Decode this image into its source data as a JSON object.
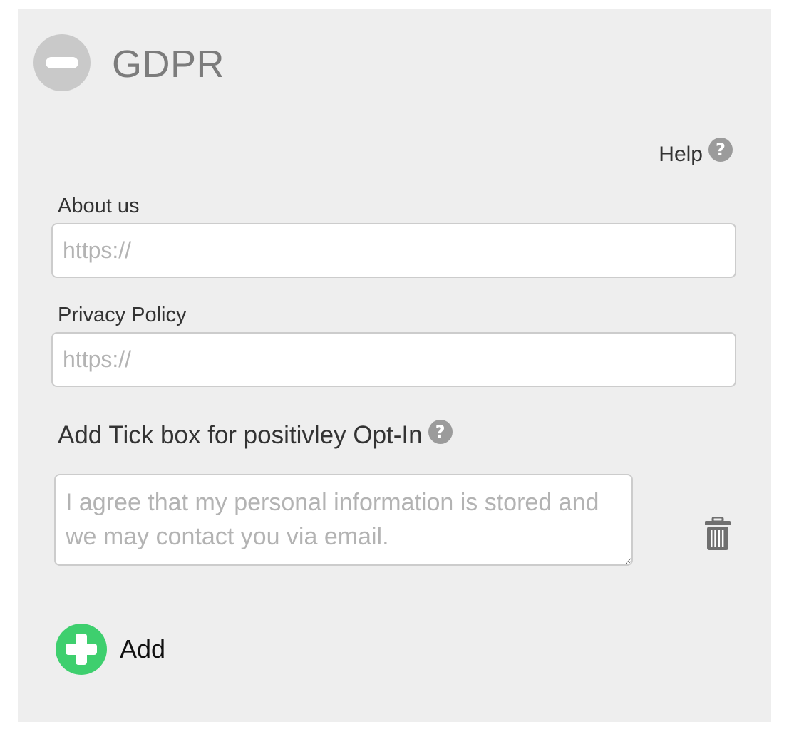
{
  "section": {
    "title": "GDPR",
    "collapse_icon": "minus-circle-icon"
  },
  "help": {
    "label": "Help",
    "icon": "question-circle-icon"
  },
  "fields": {
    "about_us": {
      "label": "About us",
      "placeholder": "https://",
      "value": ""
    },
    "privacy_policy": {
      "label": "Privacy Policy",
      "placeholder": "https://",
      "value": ""
    }
  },
  "optin": {
    "heading": "Add Tick box for positivley Opt-In",
    "help_icon": "question-circle-icon",
    "items": [
      {
        "placeholder": "I agree that my personal information is stored and we may contact you via email.",
        "value": "",
        "delete_icon": "trash-icon"
      }
    ],
    "add_label": "Add",
    "add_icon": "plus-circle-icon"
  },
  "colors": {
    "panel_bg": "#eeeeee",
    "add_green": "#3ecf6e",
    "icon_grey": "#9b9b9b",
    "collapse_grey": "#c9c9c9"
  }
}
